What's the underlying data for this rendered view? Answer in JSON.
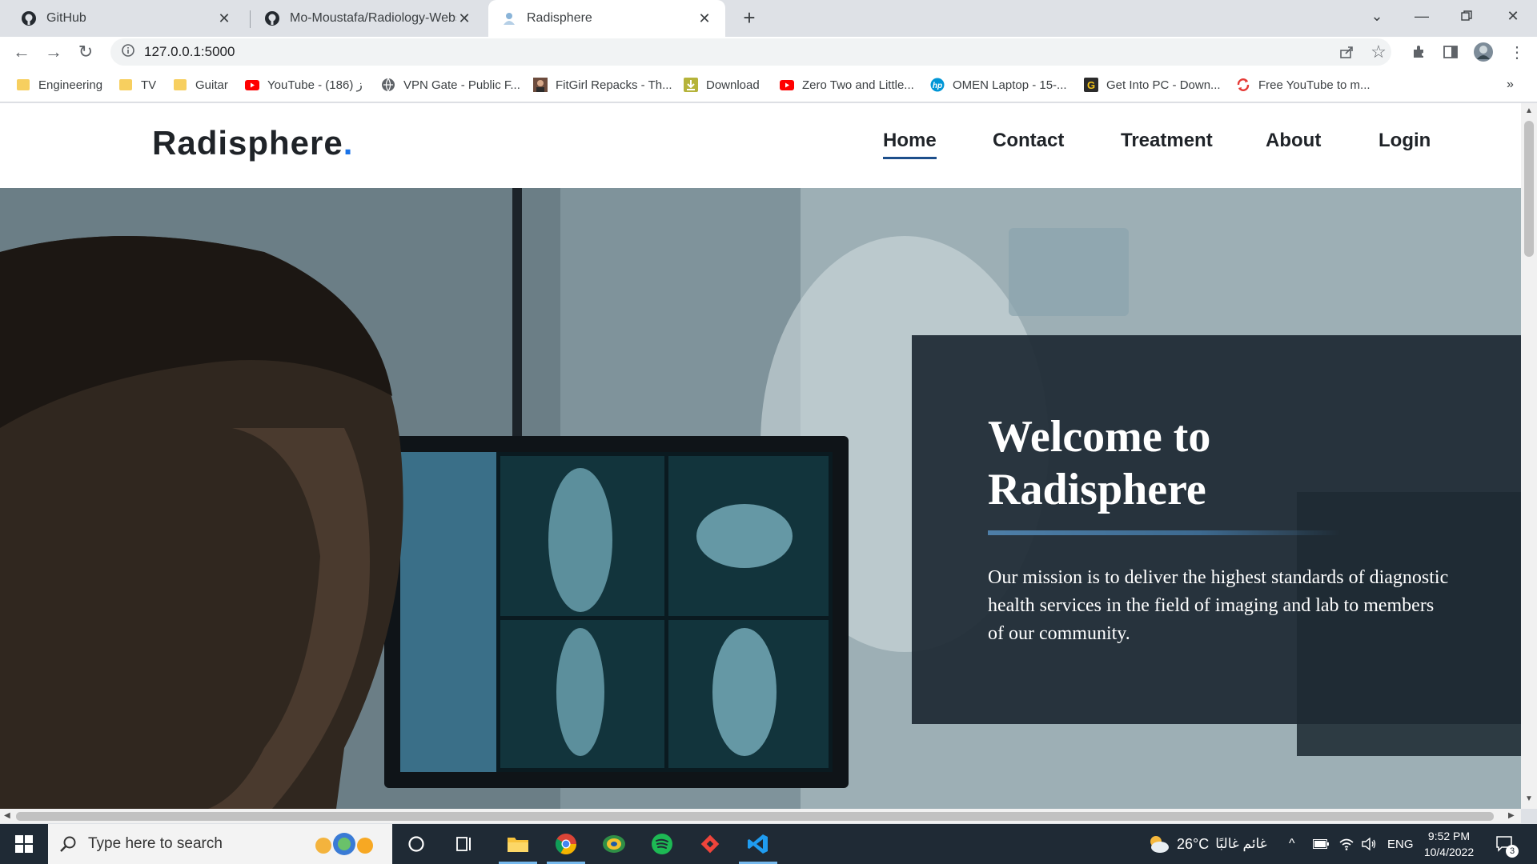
{
  "browser": {
    "tabs": [
      {
        "title": "GitHub",
        "icon": "github-icon",
        "active": false
      },
      {
        "title": "Mo-Moustafa/Radiology-Website",
        "icon": "github-icon",
        "active": false
      },
      {
        "title": "Radisphere",
        "icon": "site-favicon",
        "active": true
      }
    ],
    "url": "127.0.0.1:5000",
    "bookmarks": [
      {
        "label": "Engineering",
        "icon": "folder-icon"
      },
      {
        "label": "TV",
        "icon": "folder-icon"
      },
      {
        "label": "Guitar",
        "icon": "folder-icon"
      },
      {
        "label": "YouTube - ز (186)",
        "icon": "youtube-icon"
      },
      {
        "label": "VPN Gate - Public F...",
        "icon": "globe-icon"
      },
      {
        "label": "FitGirl Repacks - Th...",
        "icon": "fitgirl-icon"
      },
      {
        "label": "Download",
        "icon": "download-icon"
      },
      {
        "label": "Zero Two and Little...",
        "icon": "youtube-icon"
      },
      {
        "label": "OMEN Laptop - 15-...",
        "icon": "hp-icon"
      },
      {
        "label": "Get Into PC - Down...",
        "icon": "getintopc-icon"
      },
      {
        "label": "Free YouTube to m...",
        "icon": "converter-icon"
      }
    ]
  },
  "site": {
    "brand": "Radisphere",
    "brand_dot": ".",
    "nav": [
      "Home",
      "Contact",
      "Treatment",
      "About",
      "Login"
    ],
    "active_nav": "Home",
    "hero": {
      "title": "Welcome to Radisphere",
      "text": "Our mission is to deliver the highest standards of diagnostic health services in the field of imaging and lab to members of our community."
    }
  },
  "taskbar": {
    "search_placeholder": "Type here to search",
    "weather": "26°C",
    "weather_desc": "غائم غالبًا",
    "language": "ENG",
    "time": "9:52 PM",
    "date": "10/4/2022",
    "notifications": "3"
  },
  "colors": {
    "accent": "#1a73e8",
    "nav_underline": "#1d4f8b",
    "hero_box": "#1e2a34",
    "taskbar": "#1f2a35"
  }
}
